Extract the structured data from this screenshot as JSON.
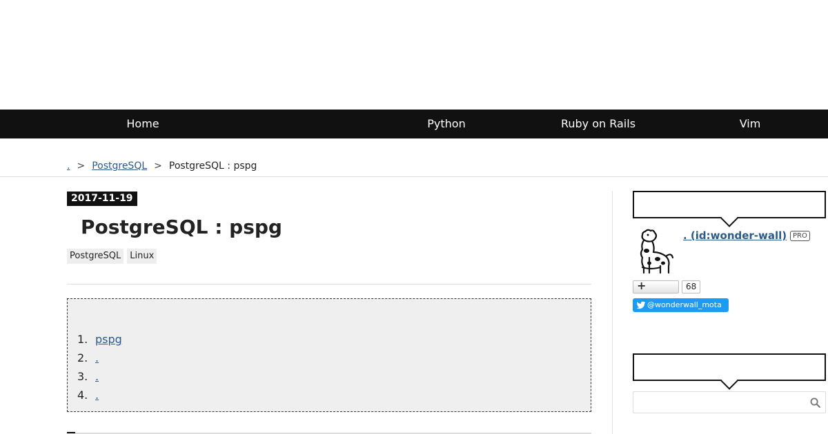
{
  "nav": {
    "items": [
      {
        "label": "Home"
      },
      {
        "label": "Python"
      },
      {
        "label": "Ruby on Rails"
      },
      {
        "label": "Vim"
      }
    ]
  },
  "breadcrumb": {
    "home": ".",
    "separator": ">",
    "category": "PostgreSQL",
    "current": "PostgreSQL : pspg"
  },
  "entry": {
    "date": "2017-11-19",
    "title": "PostgreSQL : pspg",
    "tags": [
      "PostgreSQL",
      "Linux"
    ],
    "toc": [
      {
        "num": "1.",
        "label": "pspg"
      },
      {
        "num": "2.",
        "label": "."
      },
      {
        "num": "3.",
        "label": "."
      },
      {
        "num": "4.",
        "label": "."
      }
    ]
  },
  "sidebar": {
    "profile": {
      "name": ". (id:wonder-wall)",
      "badge": "PRO",
      "follower_count": "68",
      "twitter_handle": "@wonderwall_mota"
    },
    "search": {
      "placeholder": ""
    }
  },
  "colors": {
    "nav_bg": "#111111",
    "link": "#2a5a8a",
    "twitter": "#1d9bf0"
  }
}
